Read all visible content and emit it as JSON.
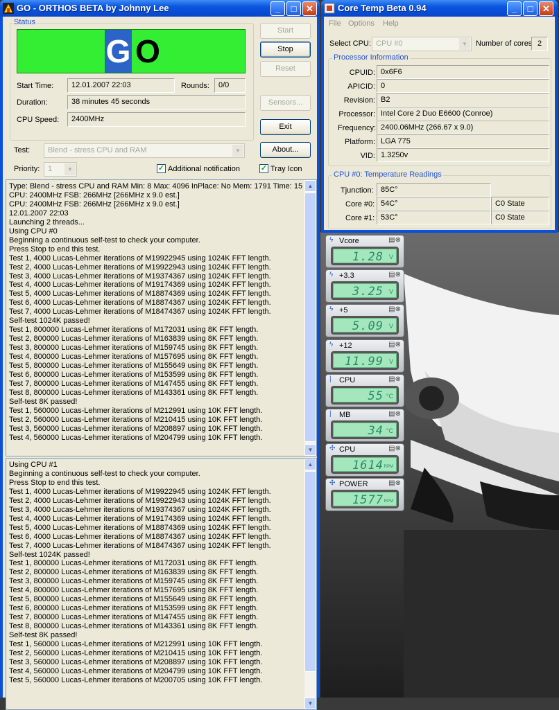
{
  "orthos": {
    "title": "GO - ORTHOS BETA by Johnny Lee",
    "status_group": "Status",
    "status_text_g": "G",
    "status_text_o": "O",
    "status_color": "#33ee33",
    "start_time_label": "Start Time:",
    "start_time": "12.01.2007 22:03",
    "rounds_label": "Rounds:",
    "rounds": "0/0",
    "duration_label": "Duration:",
    "duration": "38 minutes 45 seconds",
    "cpu_speed_label": "CPU Speed:",
    "cpu_speed": "2400MHz",
    "buttons": {
      "start": "Start",
      "stop": "Stop",
      "reset": "Reset",
      "sensors": "Sensors...",
      "exit": "Exit",
      "about": "About..."
    },
    "test_label": "Test:",
    "test_value": "Blend - stress CPU and RAM",
    "priority_label": "Priority:",
    "priority_value": "1",
    "additional_notification": "Additional notification",
    "tray_icon": "Tray Icon",
    "log1": [
      "Type: Blend - stress CPU and RAM Min: 8 Max: 4096 InPlace: No Mem: 1791 Time: 15",
      "CPU: 2400MHz FSB: 266MHz [266MHz x 9.0 est.]",
      "CPU: 2400MHz FSB: 266MHz [266MHz x 9.0 est.]",
      "12.01.2007 22:03",
      "Launching 2 threads...",
      "Using CPU #0",
      "Beginning a continuous self-test to check your computer.",
      "Press Stop to end this test.",
      "Test 1, 4000 Lucas-Lehmer iterations of M19922945 using 1024K FFT length.",
      "Test 2, 4000 Lucas-Lehmer iterations of M19922943 using 1024K FFT length.",
      "Test 3, 4000 Lucas-Lehmer iterations of M19374367 using 1024K FFT length.",
      "Test 4, 4000 Lucas-Lehmer iterations of M19174369 using 1024K FFT length.",
      "Test 5, 4000 Lucas-Lehmer iterations of M18874369 using 1024K FFT length.",
      "Test 6, 4000 Lucas-Lehmer iterations of M18874367 using 1024K FFT length.",
      "Test 7, 4000 Lucas-Lehmer iterations of M18474367 using 1024K FFT length.",
      "Self-test 1024K passed!",
      "Test 1, 800000 Lucas-Lehmer iterations of M172031 using 8K FFT length.",
      "Test 2, 800000 Lucas-Lehmer iterations of M163839 using 8K FFT length.",
      "Test 3, 800000 Lucas-Lehmer iterations of M159745 using 8K FFT length.",
      "Test 4, 800000 Lucas-Lehmer iterations of M157695 using 8K FFT length.",
      "Test 5, 800000 Lucas-Lehmer iterations of M155649 using 8K FFT length.",
      "Test 6, 800000 Lucas-Lehmer iterations of M153599 using 8K FFT length.",
      "Test 7, 800000 Lucas-Lehmer iterations of M147455 using 8K FFT length.",
      "Test 8, 800000 Lucas-Lehmer iterations of M143361 using 8K FFT length.",
      "Self-test 8K passed!",
      "Test 1, 560000 Lucas-Lehmer iterations of M212991 using 10K FFT length.",
      "Test 2, 560000 Lucas-Lehmer iterations of M210415 using 10K FFT length.",
      "Test 3, 560000 Lucas-Lehmer iterations of M208897 using 10K FFT length.",
      "Test 4, 560000 Lucas-Lehmer iterations of M204799 using 10K FFT length."
    ],
    "log2": [
      "Using CPU #1",
      "Beginning a continuous self-test to check your computer.",
      "Press Stop to end this test.",
      "Test 1, 4000 Lucas-Lehmer iterations of M19922945 using 1024K FFT length.",
      "Test 2, 4000 Lucas-Lehmer iterations of M19922943 using 1024K FFT length.",
      "Test 3, 4000 Lucas-Lehmer iterations of M19374367 using 1024K FFT length.",
      "Test 4, 4000 Lucas-Lehmer iterations of M19174369 using 1024K FFT length.",
      "Test 5, 4000 Lucas-Lehmer iterations of M18874369 using 1024K FFT length.",
      "Test 6, 4000 Lucas-Lehmer iterations of M18874367 using 1024K FFT length.",
      "Test 7, 4000 Lucas-Lehmer iterations of M18474367 using 1024K FFT length.",
      "Self-test 1024K passed!",
      "Test 1, 800000 Lucas-Lehmer iterations of M172031 using 8K FFT length.",
      "Test 2, 800000 Lucas-Lehmer iterations of M163839 using 8K FFT length.",
      "Test 3, 800000 Lucas-Lehmer iterations of M159745 using 8K FFT length.",
      "Test 4, 800000 Lucas-Lehmer iterations of M157695 using 8K FFT length.",
      "Test 5, 800000 Lucas-Lehmer iterations of M155649 using 8K FFT length.",
      "Test 6, 800000 Lucas-Lehmer iterations of M153599 using 8K FFT length.",
      "Test 7, 800000 Lucas-Lehmer iterations of M147455 using 8K FFT length.",
      "Test 8, 800000 Lucas-Lehmer iterations of M143361 using 8K FFT length.",
      "Self-test 8K passed!",
      "Test 1, 560000 Lucas-Lehmer iterations of M212991 using 10K FFT length.",
      "Test 2, 560000 Lucas-Lehmer iterations of M210415 using 10K FFT length.",
      "Test 3, 560000 Lucas-Lehmer iterations of M208897 using 10K FFT length.",
      "Test 4, 560000 Lucas-Lehmer iterations of M204799 using 10K FFT length.",
      "Test 5, 560000 Lucas-Lehmer iterations of M200705 using 10K FFT length."
    ]
  },
  "coretemp": {
    "title": "Core Temp Beta 0.94",
    "menu": [
      "File",
      "Options",
      "Help"
    ],
    "select_cpu_label": "Select CPU:",
    "select_cpu_value": "CPU #0",
    "num_cores_label": "Number of cores",
    "num_cores": "2",
    "proc_info_title": "Processor Information",
    "info": [
      {
        "label": "CPUID:",
        "value": "0x6F6"
      },
      {
        "label": "APICID:",
        "value": "0"
      },
      {
        "label": "Revision:",
        "value": "B2"
      },
      {
        "label": "Processor:",
        "value": "Intel Core 2 Duo E6600 (Conroe)"
      },
      {
        "label": "Frequency:",
        "value": "2400.06MHz (266.67 x 9.0)"
      },
      {
        "label": "Platform:",
        "value": "LGA 775"
      },
      {
        "label": "VID:",
        "value": "1.3250v"
      }
    ],
    "temp_title": "CPU #0: Temperature Readings",
    "tjunction_label": "Tjunction:",
    "tjunction": "85C°",
    "core0_label": "Core #0:",
    "core0": "54C°",
    "core0_state": "C0 State",
    "core1_label": "Core #1:",
    "core1": "53C°",
    "core1_state": "C0 State"
  },
  "gadgets": [
    {
      "name": "Vcore",
      "value": "1.28",
      "unit": "V",
      "icon": "lightning-icon"
    },
    {
      "name": "+3.3",
      "value": "3.25",
      "unit": "V",
      "icon": "lightning-icon"
    },
    {
      "name": "+5",
      "value": "5.09",
      "unit": "V",
      "icon": "lightning-icon"
    },
    {
      "name": "+12",
      "value": "11.99",
      "unit": "V",
      "icon": "lightning-icon"
    },
    {
      "name": "CPU",
      "value": "55",
      "unit": "°C",
      "icon": "thermometer-icon"
    },
    {
      "name": "MB",
      "value": "34",
      "unit": "°C",
      "icon": "thermometer-icon"
    },
    {
      "name": "CPU",
      "value": "1614",
      "unit": "RPM",
      "icon": "fan-icon"
    },
    {
      "name": "POWER",
      "value": "1577",
      "unit": "RPM",
      "icon": "fan-icon"
    }
  ]
}
